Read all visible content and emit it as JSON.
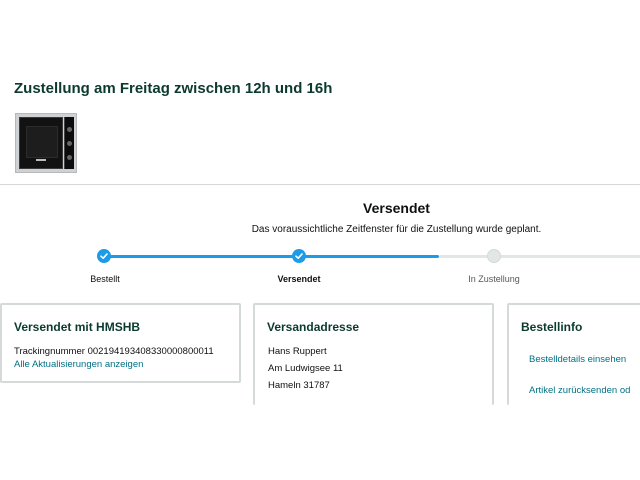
{
  "delivery": {
    "title": "Zustellung am Freitag zwischen 12h und 16h"
  },
  "product": {
    "image_icon": "oven-product-image"
  },
  "status": {
    "title": "Versendet",
    "subtitle": "Das voraussichtliche Zeitfenster für die Zustellung wurde geplant."
  },
  "progress": {
    "steps": [
      {
        "label": "Bestellt",
        "done": true
      },
      {
        "label": "Versendet",
        "done": true,
        "current": true
      },
      {
        "label": "In Zustellung",
        "done": false
      }
    ],
    "colors": {
      "done": "#1c9be6",
      "todo": "#e3e6e6"
    }
  },
  "shipping_card": {
    "title": "Versendet mit HMSHB",
    "tracking_label": "Trackingnummer",
    "tracking_number": "002194193408330000800011",
    "updates_link": "Alle Aktualisierungen anzeigen"
  },
  "address_card": {
    "title": "Versandadresse",
    "name": "Hans Ruppert",
    "street": "Am Ludwigsee 11",
    "city": "Hameln 31787"
  },
  "order_card": {
    "title": "Bestellinfo",
    "details_link": "Bestelldetails einsehen",
    "return_link": "Artikel zurücksenden od"
  },
  "colors": {
    "heading": "#0c3a2e",
    "link": "#007185",
    "border": "#d5d9d9"
  }
}
